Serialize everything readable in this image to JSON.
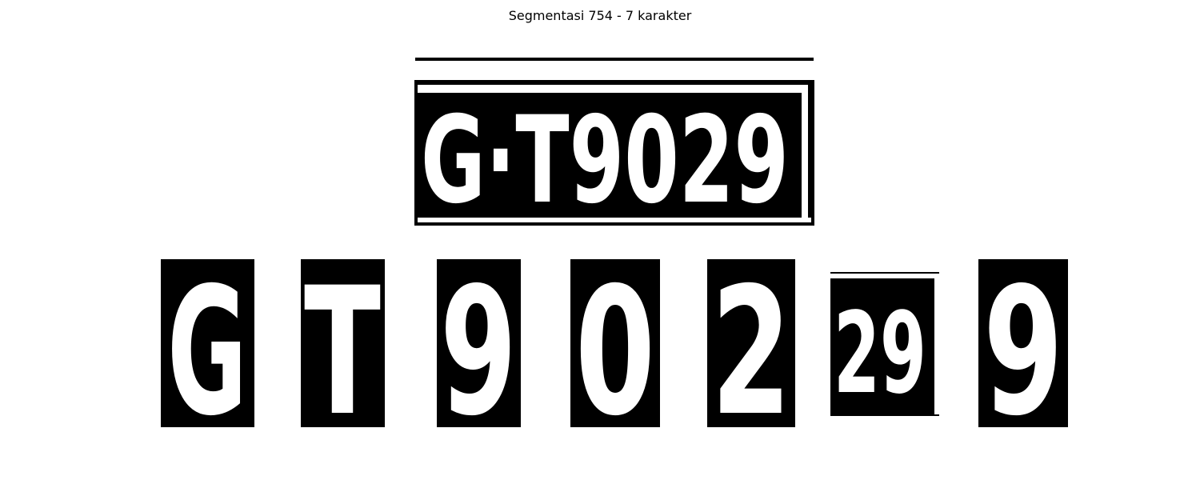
{
  "figure": {
    "title": "Segmentasi 754 - 7 karakter"
  },
  "colors": {
    "foreground": "#ffffff",
    "background": "#000000",
    "page": "#ffffff"
  },
  "plate": {
    "text": "G·T9029"
  },
  "segments": [
    {
      "char": "G"
    },
    {
      "char": "T"
    },
    {
      "char": "9"
    },
    {
      "char": "0"
    },
    {
      "char": "2"
    },
    {
      "char": "29"
    },
    {
      "char": "9"
    }
  ]
}
